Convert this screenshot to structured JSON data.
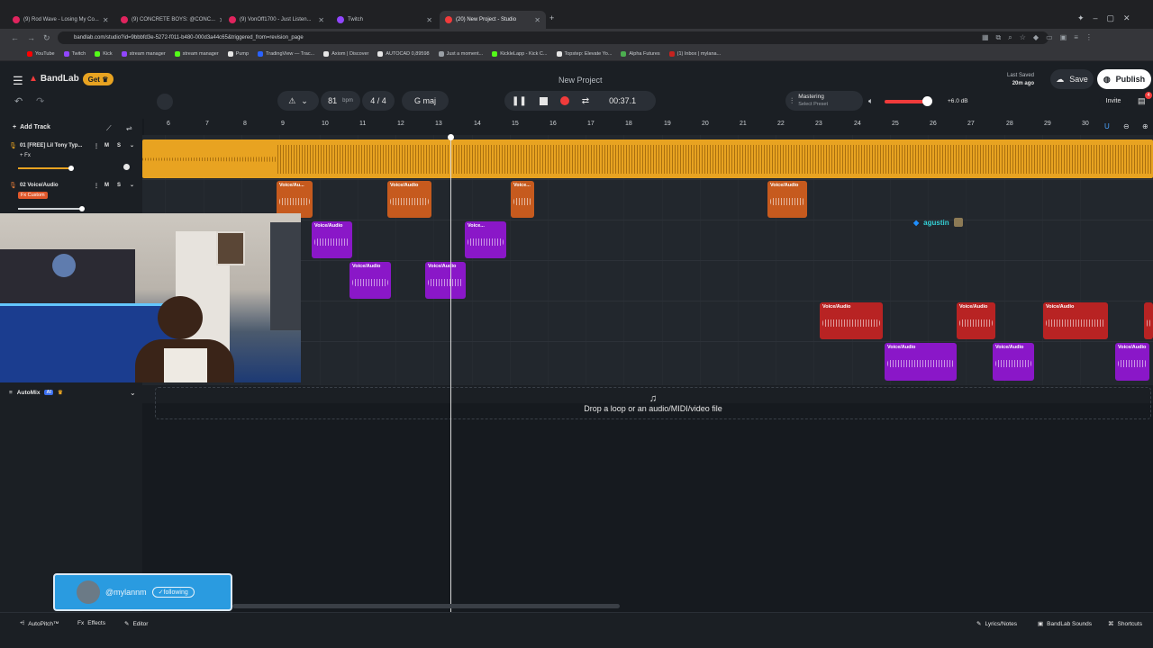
{
  "browser": {
    "tabs": [
      {
        "label": "(9) Rod Wave - Losing My Co..."
      },
      {
        "label": "(9) CONCRETE BOYS: @CONC..."
      },
      {
        "label": "(9) VonOff1700 - Just Listen..."
      },
      {
        "label": "Twitch"
      },
      {
        "label": "(20) New Project - Studio"
      }
    ],
    "url": "bandlab.com/studio?id=9bbbfd3e-5272-f011-b480-000d3a44c65&triggered_from=revision_page",
    "bookmarks": [
      "YouTube",
      "Twitch",
      "Kick",
      "stream manager",
      "stream manager",
      "Pump",
      "TradingView — Trac...",
      "Axiom | Discover",
      "AUTOCAD 0,89598",
      "Just a moment...",
      "KickleLapp - Kick C...",
      "Topstep: Elevate Yo...",
      "Alpha Futures",
      "(1) Inbox | mylana..."
    ]
  },
  "app": {
    "logo": "BandLab",
    "get_label": "Get",
    "project_title": "New Project",
    "last_saved_label": "Last Saved",
    "last_saved_time": "20m ago",
    "save_label": "Save",
    "publish_label": "Publish",
    "invite_label": "Invite",
    "bpm": "81",
    "bpm_unit": "bpm",
    "time_sig": "4 / 4",
    "key": "G maj",
    "time": "00:37.1",
    "mastering_label": "Mastering",
    "mastering_preset": "Select Preset",
    "volume_db": "+6.0 dB",
    "notification_count": "4"
  },
  "tracks_panel": {
    "add_track": "Add Track",
    "tracks": [
      {
        "name": "01  [FREE] Lil Tony Typ...",
        "sub": "+ Fx",
        "mute": "M",
        "solo": "S"
      },
      {
        "name": "02  Voice/Audio",
        "sub": "Fx Custom",
        "mute": "M",
        "solo": "S"
      }
    ],
    "automix": "AutoMix",
    "automix_badge": "AI"
  },
  "ruler": [
    "6",
    "7",
    "8",
    "9",
    "10",
    "11",
    "12",
    "13",
    "14",
    "15",
    "16",
    "17",
    "18",
    "19",
    "20",
    "21",
    "22",
    "23",
    "24",
    "25",
    "26",
    "27",
    "28",
    "29",
    "30"
  ],
  "clip_label": "Voice/Audio",
  "clip_label_short": "Voice/Au...",
  "clip_label_short2": "Voice...",
  "collaborator": "agustin",
  "dropzone": "Drop a loop or an audio/MIDI/video file",
  "follow": {
    "handle": "@mylannm",
    "status": "following"
  },
  "bottom": {
    "autopitch": "AutoPitch™",
    "effects": "Effects",
    "editor": "Editor",
    "lyrics": "Lyrics/Notes",
    "sounds": "BandLab Sounds",
    "shortcuts": "Shortcuts"
  },
  "colors": {
    "accent": "#f03b3b",
    "track1": "#e8a321",
    "clip_orange": "#c65a1e",
    "clip_purple": "#8a17c8",
    "clip_red": "#b82323"
  }
}
